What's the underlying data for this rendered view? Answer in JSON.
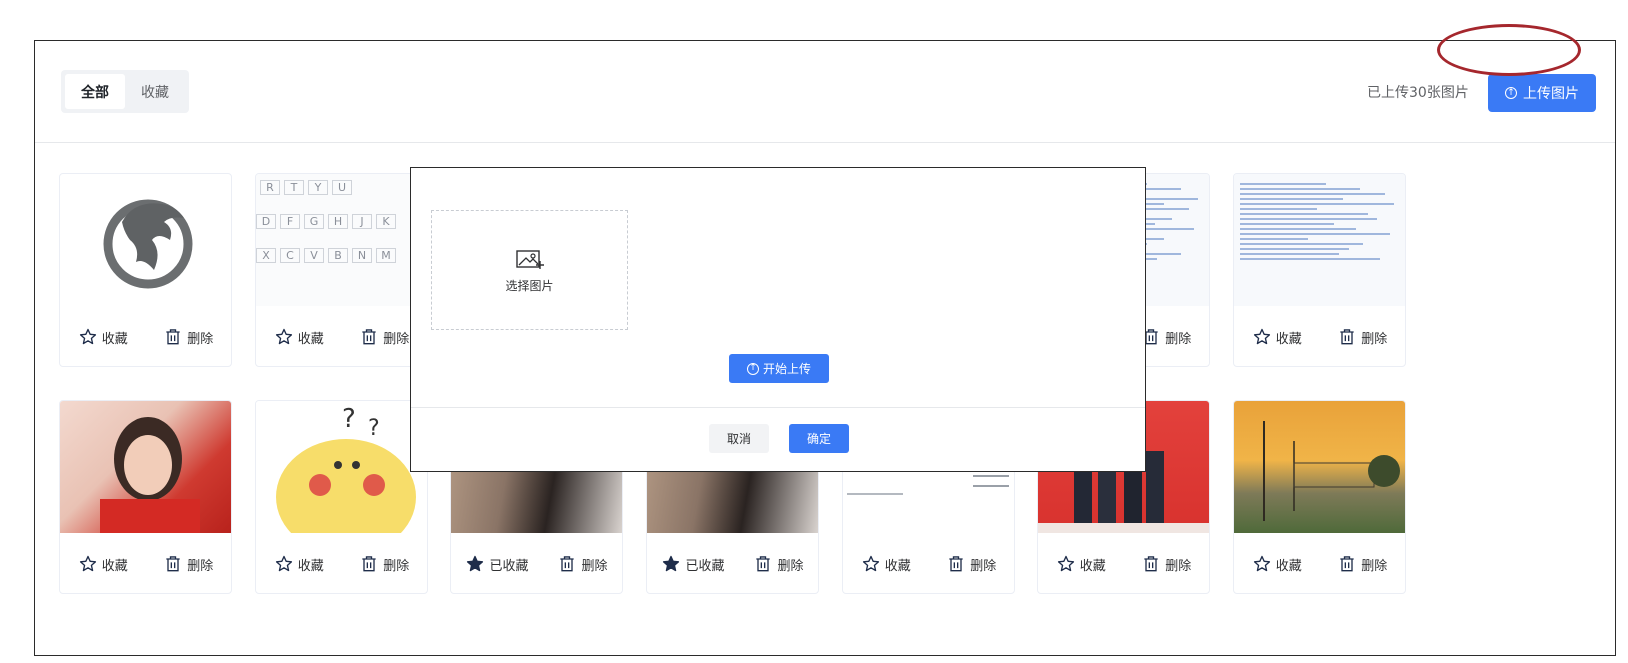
{
  "tabs": [
    {
      "label": "全部",
      "active": true
    },
    {
      "label": "收藏",
      "active": false
    }
  ],
  "header": {
    "count_text": "已上传30张图片",
    "upload_label": "上传图片"
  },
  "actions": {
    "favorite": "收藏",
    "favorited": "已收藏",
    "delete": "删除"
  },
  "cards": [
    {
      "image": "dragon-logo",
      "favorited": false
    },
    {
      "image": "keyboard-pinyin-layout",
      "favorited": false
    },
    {
      "image": "code-screenshot",
      "favorited": false
    },
    {
      "image": "code-screenshot",
      "favorited": false
    },
    {
      "image": "portrait-woman-red",
      "favorited": false
    },
    {
      "image": "pikachu-sticker",
      "favorited": false
    },
    {
      "image": "fur-close-up",
      "favorited": true
    },
    {
      "image": "fur-close-up",
      "favorited": true
    },
    {
      "image": "code-text-document",
      "favorited": false
    },
    {
      "image": "group-photo-red-background",
      "favorited": false
    },
    {
      "image": "sunset-landscape",
      "favorited": false
    }
  ],
  "keyboard": {
    "row1": [
      "R",
      "T",
      "Y",
      "U"
    ],
    "row2": [
      "D",
      "F",
      "G",
      "H",
      "J",
      "K"
    ],
    "row3": [
      "X",
      "C",
      "V",
      "B",
      "N",
      "M"
    ]
  },
  "modal": {
    "choose_image": "选择图片",
    "start_upload": "开始上传",
    "cancel": "取消",
    "confirm": "确定"
  },
  "colors": {
    "primary": "#3a7af5",
    "ring": "#a5272d",
    "icon": "#1f2d4a"
  }
}
